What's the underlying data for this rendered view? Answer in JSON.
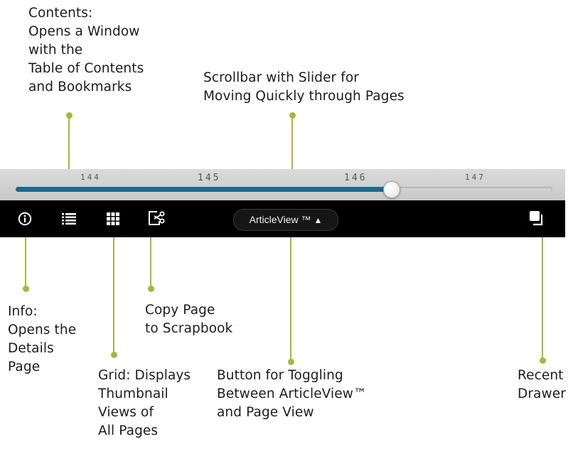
{
  "callouts": {
    "contents": [
      "Contents:",
      "Opens a Window",
      "with the",
      "Table of Contents",
      "and Bookmarks"
    ],
    "scrollbar": [
      "Scrollbar with Slider for",
      "Moving Quickly through Pages"
    ],
    "info": [
      "Info:",
      "Opens the",
      "Details",
      "Page"
    ],
    "copy_page": [
      "Copy Page",
      "to Scrapbook"
    ],
    "grid": [
      "Grid: Displays",
      "Thumbnail",
      "Views of",
      "All Pages"
    ],
    "toggle": [
      "Button for Toggling",
      "Between ArticleView™",
      "and Page View"
    ],
    "recent": [
      "Recent",
      "Drawer"
    ]
  },
  "scrollbar": {
    "page_ticks": [
      {
        "label": "144",
        "size": "small"
      },
      {
        "label": "145",
        "size": "large"
      },
      {
        "label": "146",
        "size": "large"
      },
      {
        "label": "147",
        "size": "small"
      }
    ],
    "progress_fraction": 0.7
  },
  "toolbar": {
    "info_icon": "info-icon",
    "contents_icon": "list-icon",
    "grid_icon": "grid-icon",
    "copy_icon": "copy-to-scrapbook-icon",
    "articleview_label": "ArticleView ™",
    "articleview_arrow": "▲",
    "recent_icon": "recent-drawer-icon"
  },
  "colors": {
    "leader": "#9fba3c",
    "progress": "#1b6a91",
    "toolbar_bg": "#000000"
  }
}
